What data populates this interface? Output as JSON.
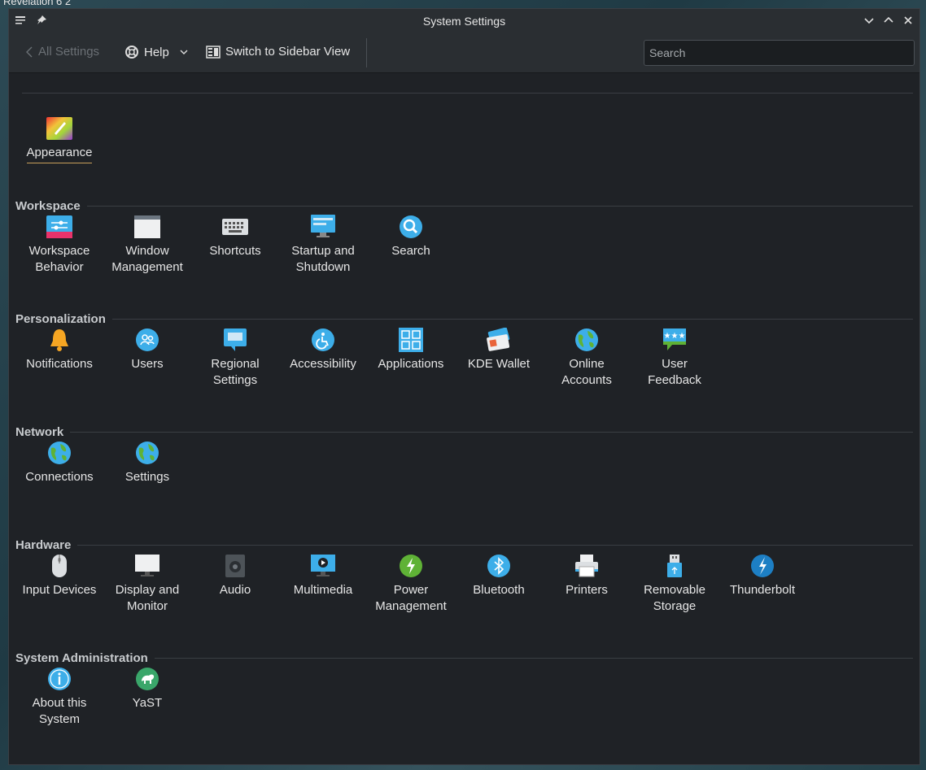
{
  "background": {
    "corner_text": "Revelation 6 2"
  },
  "window": {
    "title": "System Settings"
  },
  "toolbar": {
    "back_label": "All Settings",
    "help_label": "Help",
    "switch_label": "Switch to Sidebar View",
    "search_placeholder": "Search"
  },
  "colors": {
    "accent": "#c9a05a",
    "window_bg": "#1f2226",
    "titlebar_bg": "#2a2e32"
  },
  "sections": [
    {
      "title": "",
      "items": [
        {
          "label": "Appearance",
          "icon": "appearance-icon"
        }
      ]
    },
    {
      "title": "Workspace",
      "items": [
        {
          "label": "Workspace\nBehavior",
          "icon": "workspace-behavior-icon"
        },
        {
          "label": "Window\nManagement",
          "icon": "window-management-icon"
        },
        {
          "label": "Shortcuts",
          "icon": "keyboard-icon"
        },
        {
          "label": "Startup and\nShutdown",
          "icon": "startup-icon"
        },
        {
          "label": "Search",
          "icon": "search-icon"
        }
      ]
    },
    {
      "title": "Personalization",
      "items": [
        {
          "label": "Notifications",
          "icon": "bell-icon"
        },
        {
          "label": "Users",
          "icon": "users-icon"
        },
        {
          "label": "Regional\nSettings",
          "icon": "regional-icon"
        },
        {
          "label": "Accessibility",
          "icon": "accessibility-icon"
        },
        {
          "label": "Applications",
          "icon": "applications-icon"
        },
        {
          "label": "KDE Wallet",
          "icon": "wallet-icon"
        },
        {
          "label": "Online\nAccounts",
          "icon": "globe-icon"
        },
        {
          "label": "User\nFeedback",
          "icon": "feedback-icon"
        }
      ]
    },
    {
      "title": "Network",
      "items": [
        {
          "label": "Connections",
          "icon": "globe-icon"
        },
        {
          "label": "Settings",
          "icon": "globe-icon"
        }
      ]
    },
    {
      "title": "Hardware",
      "items": [
        {
          "label": "Input Devices",
          "icon": "mouse-icon"
        },
        {
          "label": "Display and\nMonitor",
          "icon": "monitor-icon"
        },
        {
          "label": "Audio",
          "icon": "speaker-icon"
        },
        {
          "label": "Multimedia",
          "icon": "multimedia-icon"
        },
        {
          "label": "Power\nManagement",
          "icon": "power-icon"
        },
        {
          "label": "Bluetooth",
          "icon": "bluetooth-icon"
        },
        {
          "label": "Printers",
          "icon": "printer-icon"
        },
        {
          "label": "Removable\nStorage",
          "icon": "usb-icon"
        },
        {
          "label": "Thunderbolt",
          "icon": "thunderbolt-icon"
        }
      ]
    },
    {
      "title": "System Administration",
      "items": [
        {
          "label": "About this\nSystem",
          "icon": "info-icon"
        },
        {
          "label": "YaST",
          "icon": "yast-icon"
        }
      ]
    }
  ]
}
